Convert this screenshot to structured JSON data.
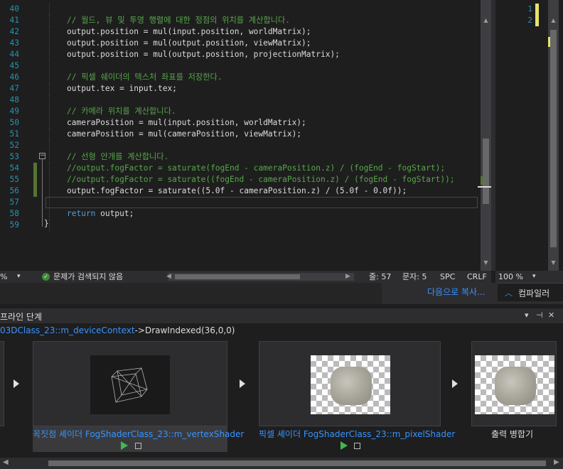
{
  "editor": {
    "lines": [
      {
        "num": "40",
        "text": "",
        "kind": "code"
      },
      {
        "num": "41",
        "text": "// 월드, 뷰 및 투영 행렬에 대한 정점의 위치를 계산합니다.",
        "kind": "comment"
      },
      {
        "num": "42",
        "text": "output.position = mul(input.position, worldMatrix);",
        "kind": "code"
      },
      {
        "num": "43",
        "text": "output.position = mul(output.position, viewMatrix);",
        "kind": "code"
      },
      {
        "num": "44",
        "text": "output.position = mul(output.position, projectionMatrix);",
        "kind": "code"
      },
      {
        "num": "45",
        "text": "",
        "kind": "code"
      },
      {
        "num": "46",
        "text": "// 픽셀 쉐이더의 텍스처 좌표를 저장한다.",
        "kind": "comment"
      },
      {
        "num": "47",
        "text": "output.tex = input.tex;",
        "kind": "code"
      },
      {
        "num": "48",
        "text": "",
        "kind": "code"
      },
      {
        "num": "49",
        "text": "// 카메라 위치를 계산합니다.",
        "kind": "comment"
      },
      {
        "num": "50",
        "text": "cameraPosition = mul(input.position, worldMatrix);",
        "kind": "code"
      },
      {
        "num": "51",
        "text": "cameraPosition = mul(cameraPosition, viewMatrix);",
        "kind": "code"
      },
      {
        "num": "52",
        "text": "",
        "kind": "code"
      },
      {
        "num": "53",
        "text": "// 선형 안개를 계산합니다.",
        "kind": "comment"
      },
      {
        "num": "54",
        "text": "//output.fogFactor = saturate(fogEnd - cameraPosition.z) / (fogEnd - fogStart);",
        "kind": "comment"
      },
      {
        "num": "55",
        "text": "//output.fogFactor = saturate((fogEnd - cameraPosition.z) / (fogEnd - fogStart));",
        "kind": "comment"
      },
      {
        "num": "56",
        "text": "output.fogFactor = saturate((5.0f - cameraPosition.z) / (5.0f - 0.0f));",
        "kind": "code"
      },
      {
        "num": "57",
        "text": "",
        "kind": "code"
      },
      {
        "num": "58",
        "text": "return output;",
        "kind": "kw-return"
      },
      {
        "num": "59",
        "text": "",
        "kind": "code"
      }
    ],
    "closing_brace": "}",
    "split_icon": "split-icon"
  },
  "side_panel": {
    "line_numbers": [
      "1",
      "2"
    ],
    "zoom": "100 %",
    "zoom_arrow": "▾"
  },
  "status": {
    "zoom": "%",
    "issues": "문제가 검색되지 않음",
    "line": "줄: 57",
    "col": "문자: 5",
    "spc": "SPC",
    "eol": "CRLF"
  },
  "tabs": {
    "copy_link": "다음으로 복사...",
    "compiler_tab": "컴파일러"
  },
  "pipeline": {
    "title": "프라인 단계",
    "context_object": "03DClass_23::m_deviceContext",
    "context_call": "->DrawIndexed(36,0,0)",
    "stages": [
      {
        "label": "꼭짓점 셰이더 FogShaderClass_23::m_vertexShader"
      },
      {
        "label": "픽셀 셰이더 FogShaderClass_23::m_pixelShader"
      },
      {
        "label": "출력 병합기"
      }
    ],
    "controls": [
      "▾",
      "⊣",
      "✕"
    ]
  },
  "colors": {
    "accent": "#3794ff",
    "comment": "#57a64a",
    "keyword": "#569cd6",
    "line_number": "#2b91af",
    "play": "#3fb950"
  }
}
